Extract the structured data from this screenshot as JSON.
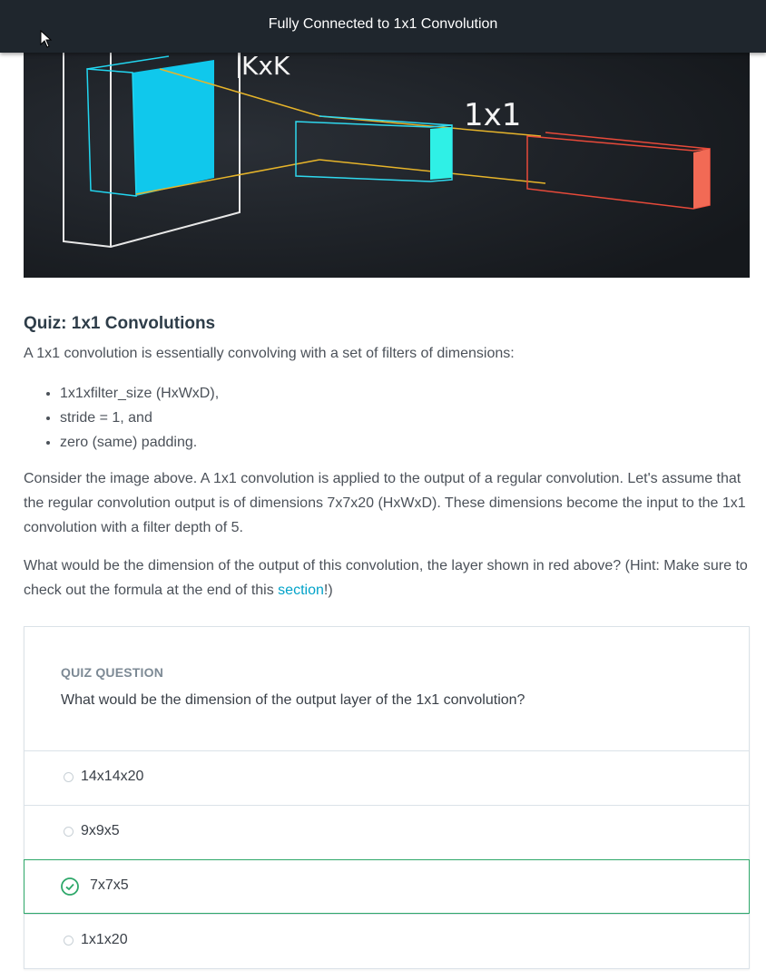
{
  "header": {
    "title": "Fully Connected to 1x1 Convolution"
  },
  "figure": {
    "label_kxk": "KxK",
    "label_1x1": "1x1"
  },
  "content": {
    "heading": "Quiz: 1x1 Convolutions",
    "intro": "A 1x1 convolution is essentially convolving with a set of filters of dimensions:",
    "bullets": [
      "1x1xfilter_size (HxWxD),",
      "stride = 1, and",
      "zero (same) padding."
    ],
    "para1": "Consider the image above. A 1x1 convolution is applied to the output of a regular convolution. Let's assume that the regular convolution output is of dimensions 7x7x20 (HxWxD). These dimensions become the input to the 1x1 convolution with a filter depth of 5.",
    "para2_before": "What would be the dimension of the output of this convolution, the layer shown in red above? (Hint: Make sure to check out the formula at the end of this ",
    "para2_link": "section",
    "para2_after": "!)"
  },
  "quiz": {
    "kicker": "QUIZ QUESTION",
    "question": "What would be the dimension of the output layer of the 1x1 convolution?",
    "options": [
      {
        "label": "14x14x20",
        "selected": false
      },
      {
        "label": "9x9x5",
        "selected": false
      },
      {
        "label": "7x7x5",
        "selected": true,
        "correct": true
      },
      {
        "label": "1x1x20",
        "selected": false
      }
    ]
  },
  "colors": {
    "accent": "#02a3c9",
    "correct": "#2ea86a",
    "topbar": "#1f262d"
  }
}
